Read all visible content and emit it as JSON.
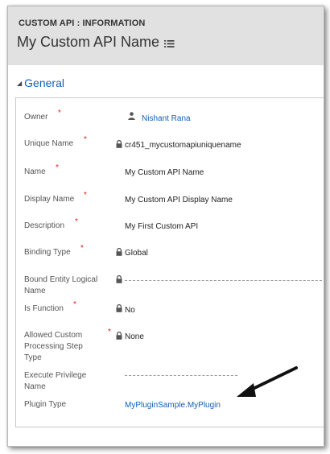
{
  "header": {
    "entity_label": "CUSTOM API : INFORMATION",
    "record_title": "My Custom API Name"
  },
  "section": {
    "title": "General"
  },
  "fields": {
    "owner": {
      "label": "Owner",
      "value": "Nishant Rana"
    },
    "unique_name": {
      "label": "Unique Name",
      "value": "cr451_mycustomapiuniquename"
    },
    "name": {
      "label": "Name",
      "value": "My Custom API Name"
    },
    "display_name": {
      "label": "Display Name",
      "value": "My Custom API Display Name"
    },
    "description": {
      "label": "Description",
      "value": "My First Custom API"
    },
    "binding_type": {
      "label": "Binding Type",
      "value": "Global"
    },
    "bound_entity": {
      "label_line1": "Bound Entity Logical",
      "label_line2": "Name",
      "value": ""
    },
    "is_function": {
      "label": "Is Function",
      "value": "No"
    },
    "allowed_custom": {
      "label_line1": "Allowed Custom",
      "label_line2": "Processing Step",
      "label_line3": "Type",
      "value": "None"
    },
    "execute_privilege": {
      "label_line1": "Execute Privilege",
      "label_line2": "Name",
      "value": ""
    },
    "plugin_type": {
      "label": "Plugin Type",
      "value": "MyPluginSample.MyPlugin"
    }
  },
  "required_marker": "*",
  "colors": {
    "header_bg": "#e1e1e1",
    "link": "#1160b7",
    "required": "#e0201b"
  },
  "icons": [
    "list-menu-icon",
    "caret-down-icon",
    "user-icon",
    "lock-icon",
    "arrow-annotation-icon"
  ]
}
